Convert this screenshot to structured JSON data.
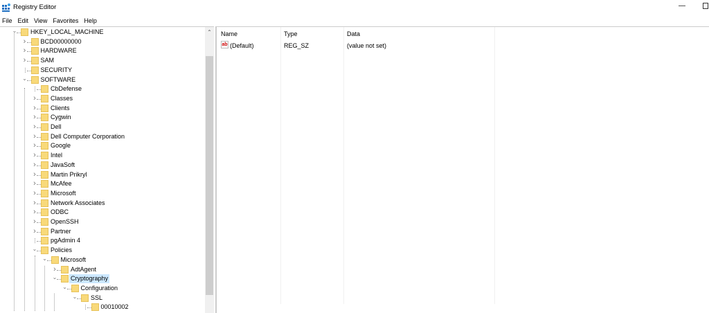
{
  "window": {
    "title": "Registry Editor",
    "minimize": "—"
  },
  "menu": [
    "File",
    "Edit",
    "View",
    "Favorites",
    "Help"
  ],
  "tree": [
    {
      "label": "HKEY_LOCAL_MACHINE",
      "level": 0,
      "state": "expanded"
    },
    {
      "label": "BCD00000000",
      "level": 1,
      "state": "collapsed"
    },
    {
      "label": "HARDWARE",
      "level": 1,
      "state": "collapsed"
    },
    {
      "label": "SAM",
      "level": 1,
      "state": "collapsed"
    },
    {
      "label": "SECURITY",
      "level": 1,
      "state": "leaf"
    },
    {
      "label": "SOFTWARE",
      "level": 1,
      "state": "expanded"
    },
    {
      "label": "CbDefense",
      "level": 2,
      "state": "leaf"
    },
    {
      "label": "Classes",
      "level": 2,
      "state": "collapsed"
    },
    {
      "label": "Clients",
      "level": 2,
      "state": "collapsed"
    },
    {
      "label": "Cygwin",
      "level": 2,
      "state": "collapsed"
    },
    {
      "label": "Dell",
      "level": 2,
      "state": "collapsed"
    },
    {
      "label": "Dell Computer Corporation",
      "level": 2,
      "state": "collapsed"
    },
    {
      "label": "Google",
      "level": 2,
      "state": "collapsed"
    },
    {
      "label": "Intel",
      "level": 2,
      "state": "collapsed"
    },
    {
      "label": "JavaSoft",
      "level": 2,
      "state": "collapsed"
    },
    {
      "label": "Martin Prikryl",
      "level": 2,
      "state": "collapsed"
    },
    {
      "label": "McAfee",
      "level": 2,
      "state": "collapsed"
    },
    {
      "label": "Microsoft",
      "level": 2,
      "state": "collapsed"
    },
    {
      "label": "Network Associates",
      "level": 2,
      "state": "collapsed"
    },
    {
      "label": "ODBC",
      "level": 2,
      "state": "collapsed"
    },
    {
      "label": "OpenSSH",
      "level": 2,
      "state": "collapsed"
    },
    {
      "label": "Partner",
      "level": 2,
      "state": "collapsed"
    },
    {
      "label": "pgAdmin 4",
      "level": 2,
      "state": "leaf"
    },
    {
      "label": "Policies",
      "level": 2,
      "state": "expanded"
    },
    {
      "label": "Microsoft",
      "level": 3,
      "state": "expanded"
    },
    {
      "label": "AdtAgent",
      "level": 4,
      "state": "collapsed"
    },
    {
      "label": "Cryptography",
      "level": 4,
      "state": "expanded",
      "selected": true
    },
    {
      "label": "Configuration",
      "level": 5,
      "state": "expanded"
    },
    {
      "label": "SSL",
      "level": 6,
      "state": "expanded"
    },
    {
      "label": "00010002",
      "level": 7,
      "state": "leaf"
    }
  ],
  "values": {
    "columns": [
      "Name",
      "Type",
      "Data"
    ],
    "rows": [
      {
        "name": "(Default)",
        "type": "REG_SZ",
        "data": "(value not set)",
        "icon": "string-value-icon"
      }
    ]
  },
  "colors": {
    "selection": "#cce8ff",
    "folder": "#f8d97a"
  }
}
